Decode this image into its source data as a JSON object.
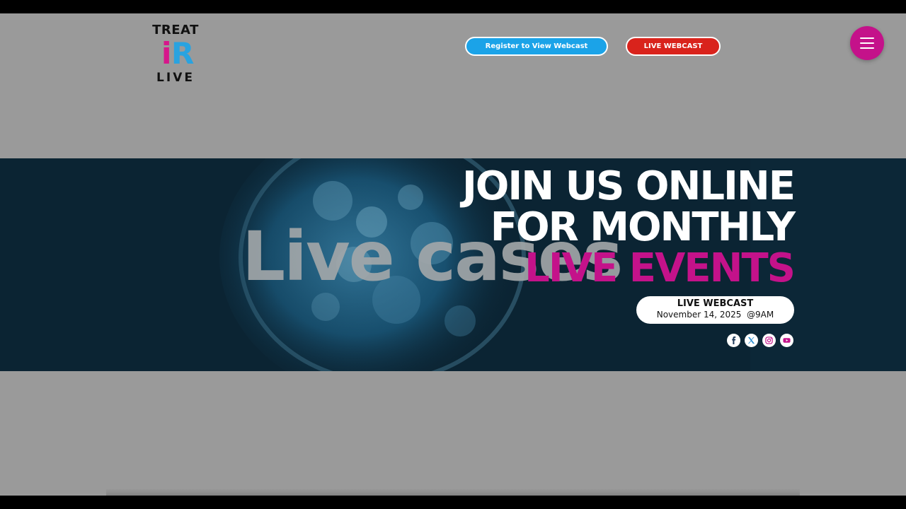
{
  "header": {
    "logo": {
      "top": "TREAT",
      "mark_i": "i",
      "mark_r": "R",
      "bottom": "LIVE"
    },
    "buttons": {
      "register_label": "Register to View Webcast",
      "live_label": "LIVE WEBCAST"
    },
    "menu_icon": "hamburger-menu-icon"
  },
  "hero": {
    "background_word": "Live cases",
    "headline_line1": "JOIN US ONLINE",
    "headline_line2": "FOR MONTHLY",
    "headline_line3": "LIVE EVENTS",
    "event": {
      "title": "LIVE WEBCAST",
      "date": "November 14, 2025  @9AM"
    },
    "socials": [
      {
        "icon": "facebook-icon"
      },
      {
        "icon": "x-twitter-icon"
      },
      {
        "icon": "instagram-icon"
      },
      {
        "icon": "youtube-icon"
      }
    ]
  },
  "colors": {
    "brand_pink": "#c4128a",
    "brand_blue": "#1ba3e8",
    "live_red": "#d9231c",
    "page_gray": "#9a9a9a",
    "hero_dark": "#0b2433"
  }
}
